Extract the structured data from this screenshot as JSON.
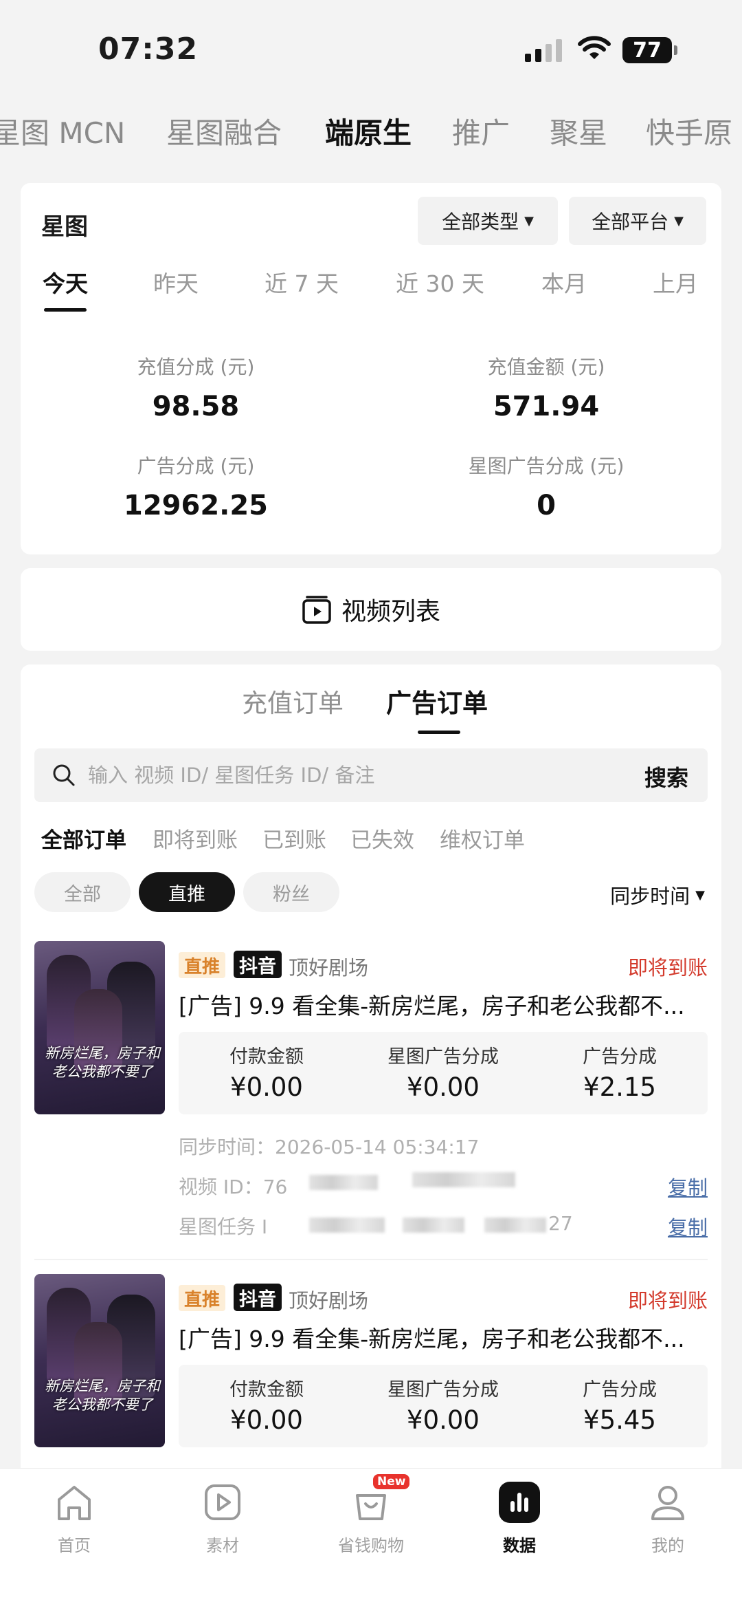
{
  "status_bar": {
    "time": "07:32",
    "battery": "77"
  },
  "top_tabs": [
    {
      "label": "星图 MCN"
    },
    {
      "label": "星图融合"
    },
    {
      "label": "端原生"
    },
    {
      "label": "推广"
    },
    {
      "label": "聚星"
    },
    {
      "label": "快手原"
    }
  ],
  "summary": {
    "title": "星图",
    "type_filter": "全部类型",
    "platform_filter": "全部平台",
    "range_tabs": [
      "今天",
      "昨天",
      "近 7 天",
      "近 30 天",
      "本月",
      "上月"
    ],
    "stats": [
      {
        "label": "充值分成 (元)",
        "value": "98.58"
      },
      {
        "label": "充值金额 (元)",
        "value": "571.94"
      },
      {
        "label": "广告分成 (元)",
        "value": "12962.25"
      },
      {
        "label": "星图广告分成 (元)",
        "value": "0"
      }
    ]
  },
  "video_list": {
    "label": "视频列表"
  },
  "orders": {
    "tabs": [
      "充值订单",
      "广告订单"
    ],
    "search": {
      "placeholder": "输入 视频 ID/ 星图任务 ID/ 备注",
      "button": "搜索"
    },
    "status_filters": [
      "全部订单",
      "即将到账",
      "已到账",
      "已失效",
      "维权订单"
    ],
    "pills": [
      "全部",
      "直推",
      "粉丝"
    ],
    "sort_label": "同步时间",
    "items": [
      {
        "tag": "直推",
        "platform": "抖音",
        "source": "顶好剧场",
        "status": "即将到账",
        "title": "[广告] 9.9 看全集-新房烂尾，房子和老公我都不...",
        "cover_text": "新房烂尾，房子和老公我都不要了",
        "amount_labels": [
          "付款金额",
          "星图广告分成",
          "广告分成"
        ],
        "amount_values": [
          "¥0.00",
          "¥0.00",
          "¥2.15"
        ],
        "sync_time": "同步时间：2026-05-14 05:34:17",
        "video_id_label": "视频 ID：76",
        "task_label": "星图任务 I",
        "task_suffix": "27",
        "copy_label": "复制"
      },
      {
        "tag": "直推",
        "platform": "抖音",
        "source": "顶好剧场",
        "status": "即将到账",
        "title": "[广告] 9.9 看全集-新房烂尾，房子和老公我都不...",
        "cover_text": "新房烂尾，房子和老公我都不要了",
        "amount_labels": [
          "付款金额",
          "星图广告分成",
          "广告分成"
        ],
        "amount_values": [
          "¥0.00",
          "¥0.00",
          "¥5.45"
        ]
      }
    ]
  },
  "bottom_nav": [
    {
      "label": "首页",
      "icon": "home-icon"
    },
    {
      "label": "素材",
      "icon": "play-icon"
    },
    {
      "label": "省钱购物",
      "icon": "shopping-bag-icon",
      "badge": "New"
    },
    {
      "label": "数据",
      "icon": "bar-chart-icon"
    },
    {
      "label": "我的",
      "icon": "profile-icon"
    }
  ],
  "colors": {
    "accent_red": "#d33a2c",
    "tag_orange": "#d9822b",
    "link_blue": "#4a6ea8"
  }
}
